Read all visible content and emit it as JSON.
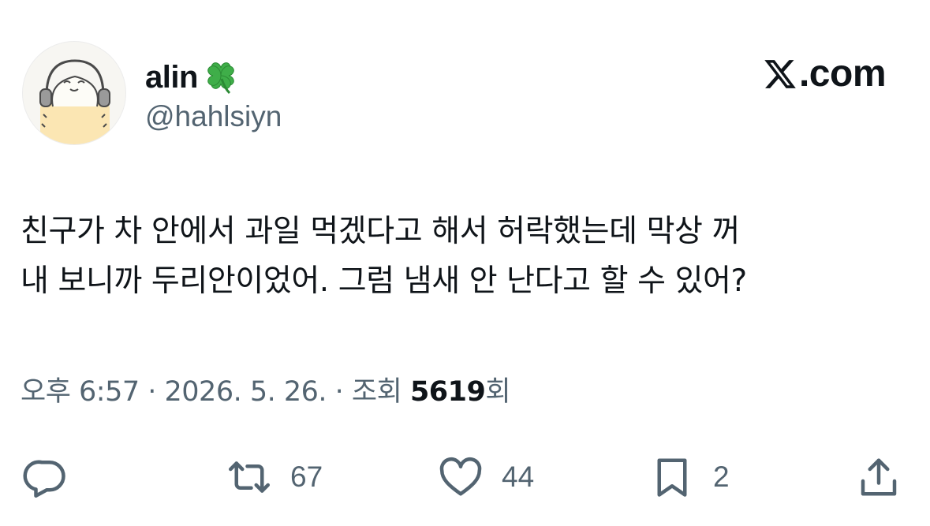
{
  "author": {
    "display_name": "alin",
    "handle": "@hahlsiyn",
    "avatar_icon": "sheep-with-headphones-avatar",
    "badge_icon": "four-leaf-clover-icon"
  },
  "brand": {
    "logo_icon": "x-logo-icon",
    "suffix": ".com"
  },
  "tweet": {
    "text_line1": "친구가 차 안에서 과일 먹겠다고 해서 허락했는데  막상 꺼",
    "text_line2": "내 보니까 두리안이었어. 그럼 냄새 안 난다고 할 수 있어?",
    "time": "오후 6:57",
    "sep1": " · ",
    "date": "2026. 5. 26.",
    "sep2": " · ",
    "views_label": "조회 ",
    "views_count": "5619",
    "views_suffix": "회"
  },
  "actions": {
    "reply": {
      "icon": "reply-icon",
      "count": ""
    },
    "retweet": {
      "icon": "retweet-icon",
      "count": "67"
    },
    "like": {
      "icon": "heart-icon",
      "count": "44"
    },
    "bookmark": {
      "icon": "bookmark-icon",
      "count": "2"
    },
    "share": {
      "icon": "share-icon",
      "count": ""
    }
  },
  "colors": {
    "text": "#0f1419",
    "secondary": "#536471",
    "clover": "#3fae49"
  }
}
